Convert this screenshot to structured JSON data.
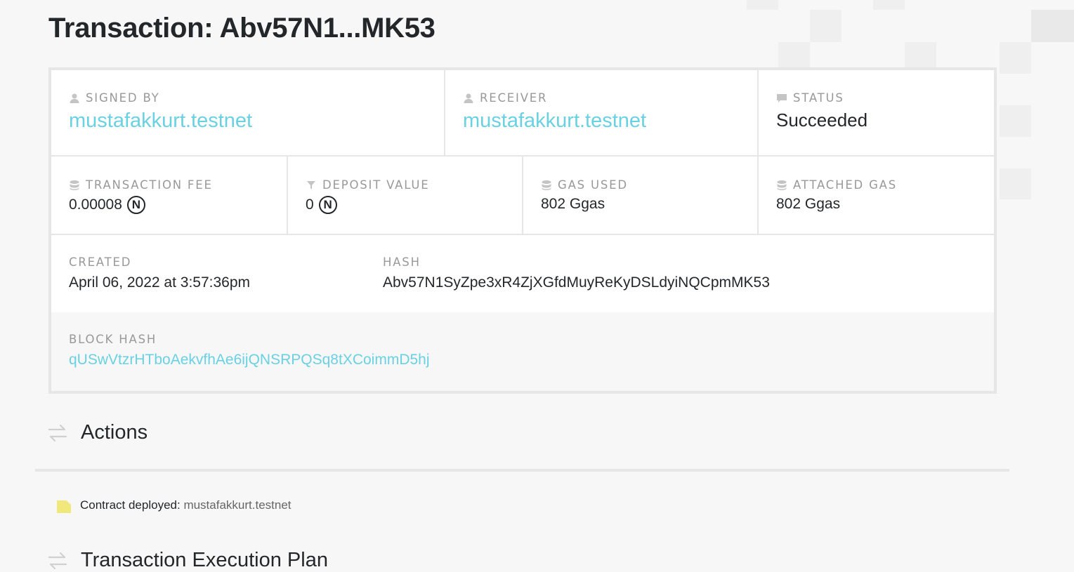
{
  "page": {
    "title": "Transaction: Abv57N1...MK53"
  },
  "overview": {
    "signed_by": {
      "label": "SIGNED BY",
      "icon": "user-icon",
      "value": "mustafakkurt.testnet"
    },
    "receiver": {
      "label": "RECEIVER",
      "icon": "user-icon",
      "value": "mustafakkurt.testnet"
    },
    "status": {
      "label": "STATUS",
      "icon": "comment-icon",
      "value": "Succeeded"
    },
    "transaction_fee": {
      "label": "TRANSACTION FEE",
      "icon": "database-icon",
      "value": "0.00008",
      "unit_icon": "N"
    },
    "deposit_value": {
      "label": "DEPOSIT VALUE",
      "icon": "filter-icon",
      "value": "0",
      "unit_icon": "N"
    },
    "gas_used": {
      "label": "GAS USED",
      "icon": "database-icon",
      "value": "802 Ggas"
    },
    "attached_gas": {
      "label": "ATTACHED GAS",
      "icon": "database-icon",
      "value": "802 Ggas"
    },
    "created": {
      "label": "CREATED",
      "value": "April 06, 2022 at 3:57:36pm"
    },
    "hash": {
      "label": "HASH",
      "value": "Abv57N1SyZpe3xR4ZjXGfdMuyReKyDSLdyiNQCpmMK53"
    },
    "block_hash": {
      "label": "BLOCK HASH",
      "value": "qUSwVtzrHTboAekvfhAe6ijQNSRPQSq8tXCoimmD5hj"
    }
  },
  "actions": {
    "title": "Actions",
    "items": [
      {
        "text": "Contract deployed:",
        "account": "mustafakkurt.testnet",
        "icon": "file-icon"
      }
    ]
  },
  "execution_plan": {
    "title": "Transaction Execution Plan"
  },
  "colors": {
    "link": "#6ad1e3",
    "label": "#999999",
    "text": "#24272a",
    "border": "#e6e6e6",
    "file_icon": "#f0e87a"
  }
}
